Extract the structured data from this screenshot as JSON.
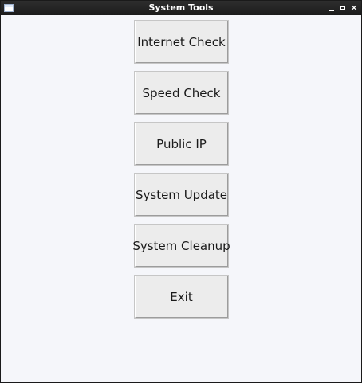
{
  "window": {
    "title": "System Tools",
    "controls": {
      "minimize_icon": "minimize-icon",
      "maximize_icon": "maximize-icon",
      "close_icon": "close-icon",
      "close_glyph": "×"
    }
  },
  "buttons": {
    "internet_check": "Internet Check",
    "speed_check": "Speed Check",
    "public_ip": "Public IP",
    "system_update": "System Update",
    "system_cleanup": "System Cleanup",
    "exit": "Exit"
  },
  "colors": {
    "titlebar": "#1b1b1b",
    "background": "#f5f6fa",
    "button_face": "#ececec"
  }
}
